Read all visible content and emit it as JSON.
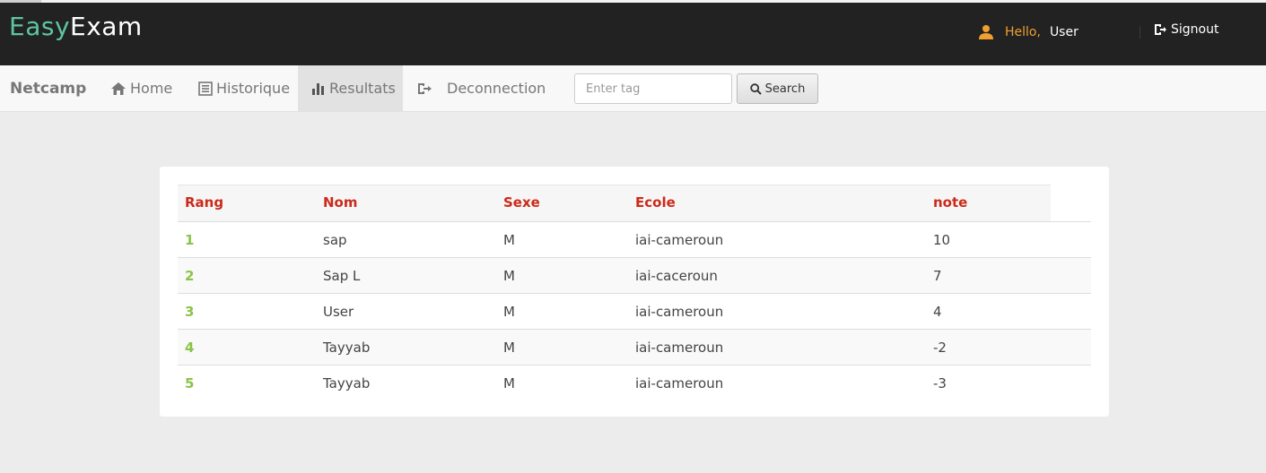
{
  "header": {
    "logo_part1": "Easy",
    "logo_part2": "Exam",
    "hello_label": "Hello,",
    "user_name": "User",
    "signout_label": "Signout"
  },
  "nav": {
    "brand": "Netcamp",
    "items": [
      {
        "label": "Home",
        "icon": "home-icon"
      },
      {
        "label": "Historique",
        "icon": "list-icon"
      },
      {
        "label": "Resultats",
        "icon": "bar-chart-icon",
        "active": true
      },
      {
        "label": "Deconnection",
        "icon": "log-out-icon"
      }
    ],
    "search_placeholder": "Enter tag",
    "search_button": "Search"
  },
  "table": {
    "headers": [
      "Rang",
      "Nom",
      "Sexe",
      "Ecole",
      "note"
    ],
    "rows": [
      [
        "1",
        "sap",
        "M",
        "iai-cameroun",
        "10"
      ],
      [
        "2",
        "Sap L",
        "M",
        "iai-caceroun",
        "7"
      ],
      [
        "3",
        "User",
        "M",
        "iai-cameroun",
        "4"
      ],
      [
        "4",
        "Tayyab",
        "M",
        "iai-cameroun",
        "-2"
      ],
      [
        "5",
        "Tayyab",
        "M",
        "iai-cameroun",
        "-3"
      ]
    ]
  },
  "colors": {
    "header_bg": "#222222",
    "logo_accent": "#5cc6a3",
    "hello": "#f0a030",
    "table_header": "#cc2a1a",
    "rank": "#8bc34a"
  }
}
